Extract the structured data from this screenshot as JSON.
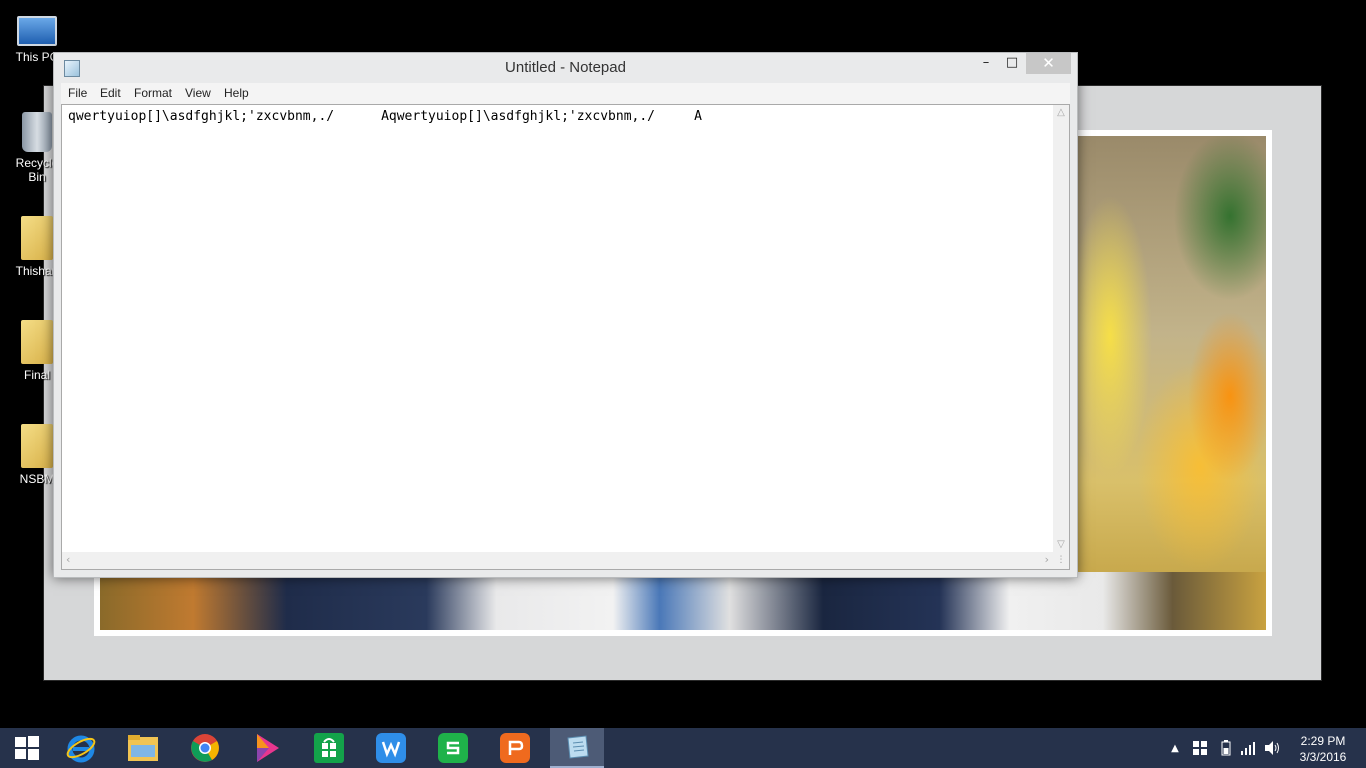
{
  "desktop": {
    "icons": [
      {
        "label": "This PC",
        "icon": "computer-icon"
      },
      {
        "label": "Recycle Bin",
        "icon": "recycle-bin-icon"
      },
      {
        "label": "Thishan",
        "icon": "user-folder-icon"
      },
      {
        "label": "Final",
        "icon": "folder-icon"
      },
      {
        "label": "NSBM",
        "icon": "folder-icon"
      }
    ]
  },
  "notepad": {
    "title": "Untitled - Notepad",
    "controls": {
      "minimize": "–",
      "maximize": "□",
      "close": "✕"
    },
    "menu": [
      "File",
      "Edit",
      "Format",
      "View",
      "Help"
    ],
    "text": "qwertyuiop[]\\asdfghjkl;'zxcvbnm,./      Aqwertyuiop[]\\asdfghjkl;'zxcvbnm,./     A"
  },
  "taskbar": {
    "pinned": [
      {
        "name": "start",
        "icon": "windows-start-icon"
      },
      {
        "name": "internet-explorer",
        "icon": "internet-explorer-icon"
      },
      {
        "name": "file-explorer",
        "icon": "file-explorer-icon"
      },
      {
        "name": "chrome",
        "icon": "chrome-icon"
      },
      {
        "name": "media-player",
        "icon": "media-player-icon"
      },
      {
        "name": "store",
        "icon": "store-icon"
      },
      {
        "name": "wps-writer",
        "icon": "wps-writer-icon"
      },
      {
        "name": "wps-spreadsheets",
        "icon": "wps-spreadsheets-icon"
      },
      {
        "name": "wps-presentation",
        "icon": "wps-presentation-icon"
      },
      {
        "name": "notepad",
        "icon": "notepad-icon",
        "active": true
      }
    ],
    "tray": {
      "icons": [
        "show-hidden-icons-arrow",
        "action-center-flag-icon",
        "battery-icon",
        "network-signal-icon",
        "volume-icon"
      ]
    },
    "clock": {
      "time": "2:29 PM",
      "date": "3/3/2016"
    }
  },
  "colors": {
    "taskbar": "#26324b",
    "title_close": "#c7c7c7",
    "ie": "#1e88e5",
    "store": "#13a34a",
    "wps_writer": "#2f8ee8",
    "wps_sheet": "#1fb24a",
    "wps_pres": "#ef6a1e"
  }
}
